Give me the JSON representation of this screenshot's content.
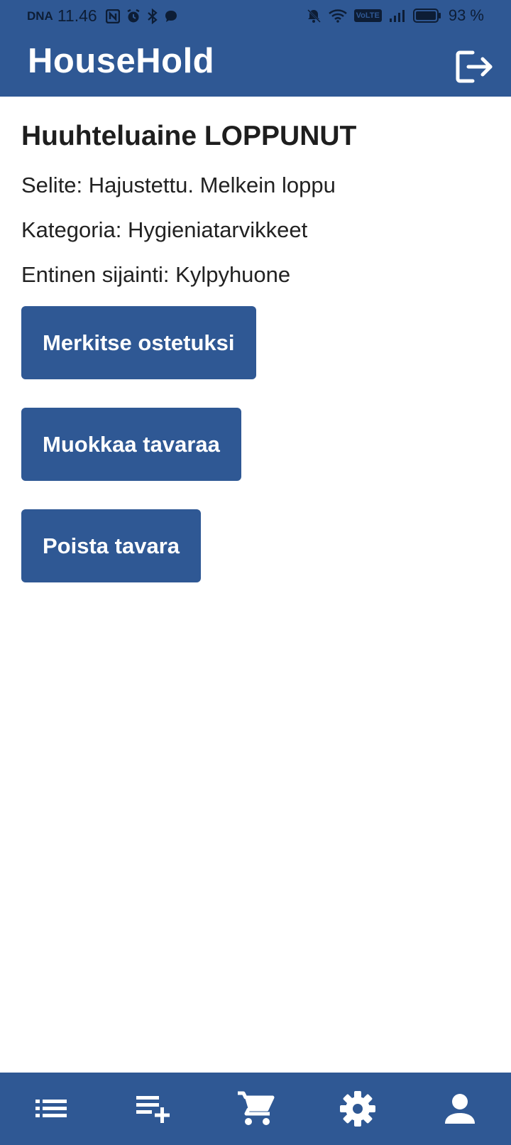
{
  "status_bar": {
    "carrier": "DNA",
    "time": "11.46",
    "volte": "VoLTE",
    "battery": "93 %"
  },
  "header": {
    "title": "HouseHold",
    "logout_icon": "logout-icon"
  },
  "item": {
    "title": "Huuhteluaine LOPPUNUT",
    "description_label": "Selite:",
    "description": "Hajustettu. Melkein loppu",
    "category_label": "Kategoria:",
    "category": "Hygieniatarvikkeet",
    "location_label": "Entinen sijainti:",
    "location": "Kylpyhuone"
  },
  "actions": {
    "mark_bought": "Merkitse ostetuksi",
    "edit_item": "Muokkaa tavaraa",
    "delete_item": "Poista tavara"
  },
  "bottom_nav": [
    {
      "icon": "list-icon"
    },
    {
      "icon": "playlist-add-icon"
    },
    {
      "icon": "cart-icon"
    },
    {
      "icon": "gear-icon"
    },
    {
      "icon": "person-icon"
    }
  ],
  "colors": {
    "primary": "#2f5894",
    "background": "#ffffff",
    "text": "#222222"
  }
}
